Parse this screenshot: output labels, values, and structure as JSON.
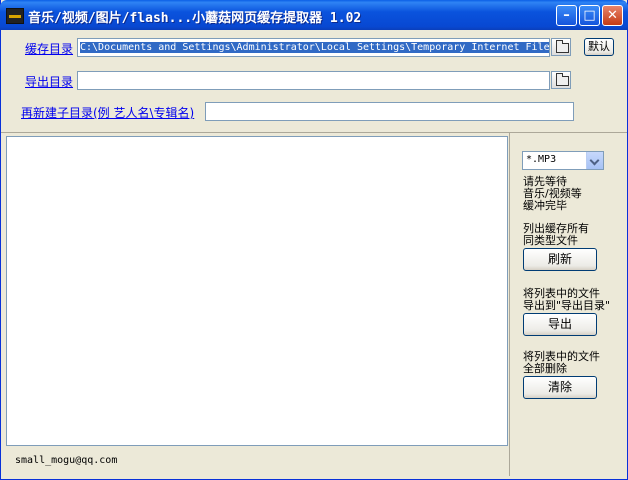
{
  "window": {
    "title": "音乐/视频/图片/flash...小蘑菇网页缓存提取器 1.02",
    "minimize": "–",
    "maximize": "□",
    "close": "✕"
  },
  "cache_dir": {
    "label": "缓存目录",
    "value": "C:\\Documents and Settings\\Administrator\\Local Settings\\Temporary Internet Files",
    "default_button": "默认",
    "browse_icon": "folder-icon"
  },
  "export_dir": {
    "label": "导出目录",
    "value": "",
    "browse_icon": "folder-icon"
  },
  "subdir": {
    "label": "再新建子目录(例 艺人名\\专辑名)",
    "value": ""
  },
  "filter": {
    "selected": "*.MP3"
  },
  "side": {
    "wait_text": [
      "请先等待",
      "音乐/视频等",
      "缓冲完毕"
    ],
    "list_text": [
      "列出缓存所有",
      "同类型文件"
    ],
    "refresh_button": "刷新",
    "export_text": [
      "将列表中的文件",
      "导出到\"导出目录\""
    ],
    "export_button": "导出",
    "delete_text": [
      "将列表中的文件",
      "全部删除"
    ],
    "clear_button": "清除"
  },
  "status": {
    "email": "small_mogu@qq.com"
  },
  "colors": {
    "titlebar": "#0a53dd",
    "window_bg": "#ece9d8",
    "link": "#0000ee",
    "selection": "#316ac5"
  }
}
